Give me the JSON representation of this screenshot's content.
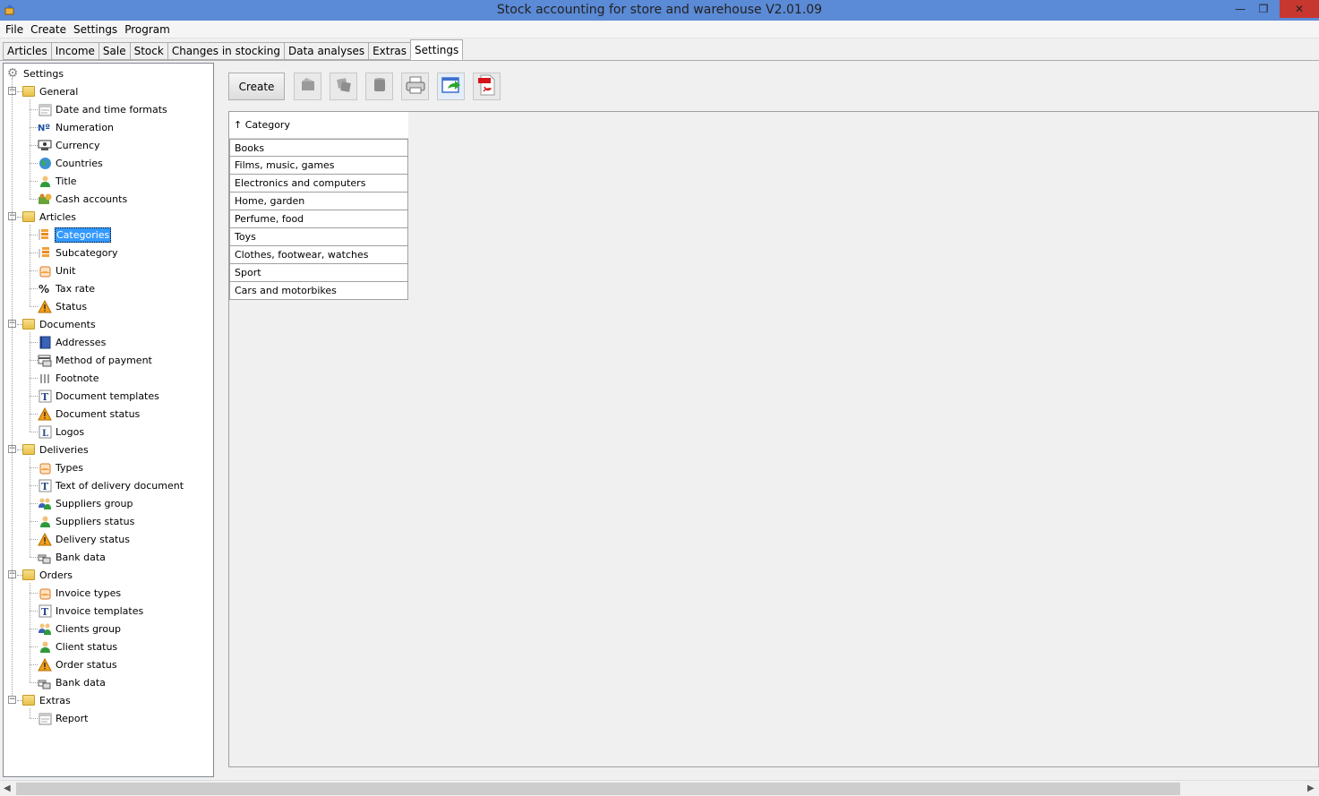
{
  "window": {
    "title": "Stock accounting for store and warehouse V2.01.09",
    "minimize": "—",
    "maximize": "❐",
    "close": "✕"
  },
  "menu": [
    "File",
    "Create",
    "Settings",
    "Program"
  ],
  "tabs": [
    "Articles",
    "Income",
    "Sale",
    "Stock",
    "Changes in stocking",
    "Data analyses",
    "Extras",
    "Settings"
  ],
  "active_tab": "Settings",
  "tree": {
    "root": "Settings",
    "groups": [
      {
        "label": "General",
        "children": [
          {
            "label": "Date and time formats",
            "icon": "calendar-icon"
          },
          {
            "label": "Numeration",
            "icon": "numero-icon"
          },
          {
            "label": "Currency",
            "icon": "currency-icon"
          },
          {
            "label": "Countries",
            "icon": "globe-icon"
          },
          {
            "label": "Title",
            "icon": "person-icon"
          },
          {
            "label": "Cash accounts",
            "icon": "cash-icon"
          }
        ]
      },
      {
        "label": "Articles",
        "children": [
          {
            "label": "Categories",
            "icon": "category-icon",
            "selected": true
          },
          {
            "label": "Subcategory",
            "icon": "subcategory-icon"
          },
          {
            "label": "Unit",
            "icon": "unit-icon"
          },
          {
            "label": "Tax rate",
            "icon": "percent-icon"
          },
          {
            "label": "Status",
            "icon": "warning-icon"
          }
        ]
      },
      {
        "label": "Documents",
        "children": [
          {
            "label": "Addresses",
            "icon": "address-book-icon"
          },
          {
            "label": "Method of payment",
            "icon": "payment-icon"
          },
          {
            "label": "Footnote",
            "icon": "footnote-icon"
          },
          {
            "label": "Document templates",
            "icon": "text-template-icon"
          },
          {
            "label": "Document status",
            "icon": "warning-icon"
          },
          {
            "label": "Logos",
            "icon": "logo-icon"
          }
        ]
      },
      {
        "label": "Deliveries",
        "children": [
          {
            "label": "Types",
            "icon": "unit-icon"
          },
          {
            "label": "Text of delivery document",
            "icon": "text-template-icon"
          },
          {
            "label": "Suppliers group",
            "icon": "group-icon"
          },
          {
            "label": "Suppliers status",
            "icon": "person-icon"
          },
          {
            "label": "Delivery status",
            "icon": "warning-icon"
          },
          {
            "label": "Bank data",
            "icon": "bank-icon"
          }
        ]
      },
      {
        "label": "Orders",
        "children": [
          {
            "label": "Invoice types",
            "icon": "unit-icon"
          },
          {
            "label": "Invoice templates",
            "icon": "text-template-icon"
          },
          {
            "label": "Clients group",
            "icon": "group-icon"
          },
          {
            "label": "Client status",
            "icon": "person-icon"
          },
          {
            "label": "Order status",
            "icon": "warning-icon"
          },
          {
            "label": "Bank data",
            "icon": "bank-icon"
          }
        ]
      },
      {
        "label": "Extras",
        "children": [
          {
            "label": "Report",
            "icon": "report-icon"
          }
        ]
      }
    ]
  },
  "toolbar": {
    "create_label": "Create",
    "tools": [
      "edit-icon",
      "copy-icon",
      "delete-icon",
      "print-icon",
      "export-icon",
      "pdf-icon"
    ],
    "pdf_label": "PDF"
  },
  "grid": {
    "header": "↑ Category",
    "rows": [
      "Books",
      "Films, music, games",
      "Electronics and computers",
      "Home, garden",
      "Perfume, food",
      "Toys",
      "Clothes, footwear, watches",
      "Sport",
      "Cars and motorbikes"
    ]
  },
  "colors": {
    "titlebar": "#5b8ad6",
    "close_button": "#c7372f",
    "selection": "#3399ff"
  }
}
